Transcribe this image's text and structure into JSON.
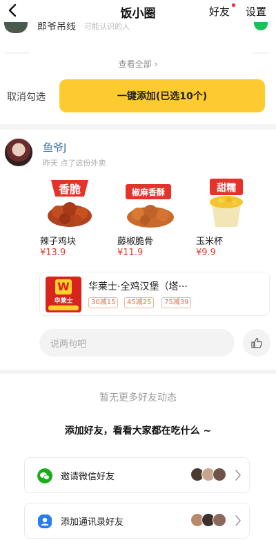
{
  "header": {
    "title": "饭小圈",
    "friends_label": "好友",
    "settings_label": "设置"
  },
  "partial_row": {
    "name": "郎爷吊线",
    "subtitle": "可能认识的人"
  },
  "view_all": {
    "label": "查看全部",
    "chevron": "›"
  },
  "selection": {
    "cancel_label": "取消勾选",
    "add_button_label": "一键添加(已选10个)"
  },
  "post": {
    "user_name": "鱼爷J",
    "meta": "昨天 点了这份外卖",
    "items": [
      {
        "name": "辣子鸡块",
        "price": "¥13.9",
        "badge": "香脆"
      },
      {
        "name": "藤椒脆骨",
        "price": "¥11.9",
        "badge": "椒麻香酥"
      },
      {
        "name": "玉米杯",
        "price": "¥9.9",
        "badge": "甜糯"
      }
    ],
    "store": {
      "logo_text": "华莱士",
      "name": "华莱士·全鸡汉堡（塔···",
      "coupons": [
        "30减15",
        "45减25",
        "75减39"
      ]
    },
    "comment_placeholder": "说两句吧"
  },
  "footer": {
    "no_more": "暂无更多好友动态",
    "invite_title": "添加好友，看看大家都在吃什么 ~",
    "cards": [
      {
        "label": "邀请微信好友",
        "icon": "wechat-icon",
        "color": "#1aad19"
      },
      {
        "label": "添加通讯录好友",
        "icon": "contacts-icon",
        "color": "#2b7de9"
      }
    ]
  },
  "colors": {
    "accent_yellow": "#fdcb2f",
    "price_red": "#e23a2d",
    "username_blue": "#3f6ea8",
    "notification_red": "#e8272f"
  }
}
